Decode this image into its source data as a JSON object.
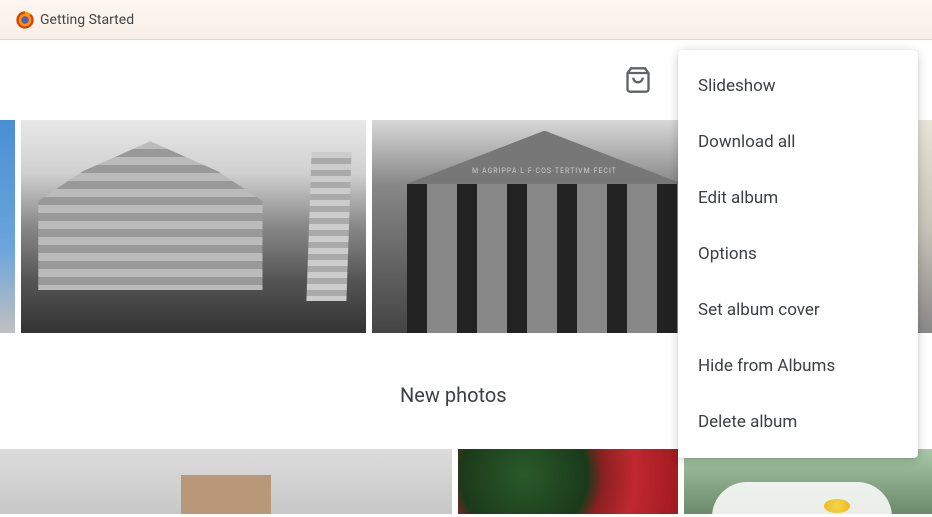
{
  "browser": {
    "tab_title": "Getting Started"
  },
  "photo_inscription": "M·AGRIPPA·L·F·COS·TERTIVM·FECIT",
  "section": {
    "new_photos_label": "New photos"
  },
  "menu": {
    "items": [
      "Slideshow",
      "Download all",
      "Edit album",
      "Options",
      "Set album cover",
      "Hide from Albums",
      "Delete album"
    ]
  }
}
